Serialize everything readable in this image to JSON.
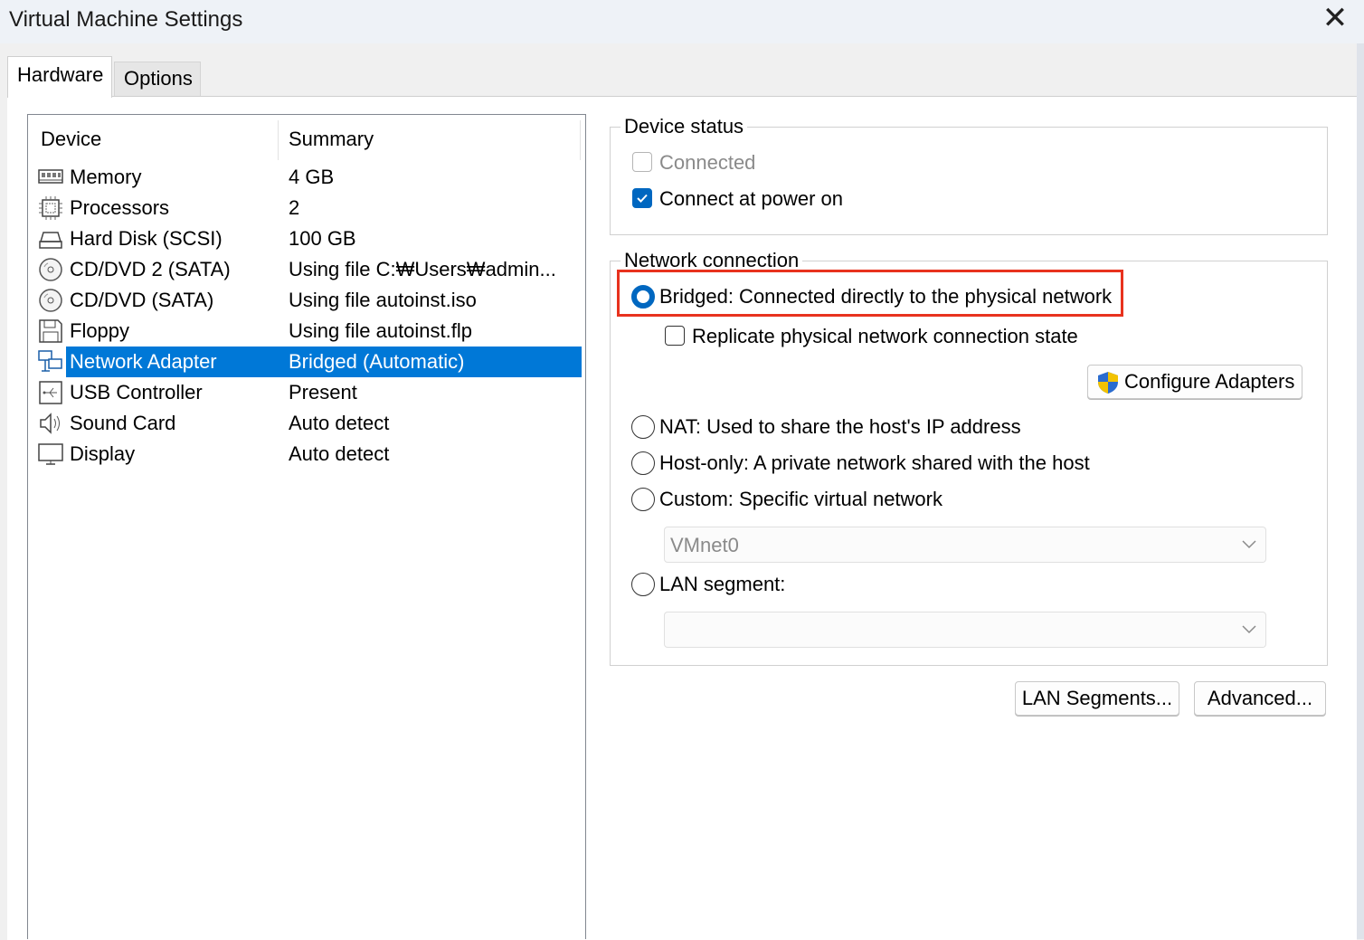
{
  "window": {
    "title": "Virtual Machine Settings",
    "close": "✕"
  },
  "tabs": [
    {
      "label": "Hardware",
      "active": true
    },
    {
      "label": "Options",
      "active": false
    }
  ],
  "device_list": {
    "headers": {
      "device": "Device",
      "summary": "Summary"
    },
    "rows": [
      {
        "icon": "memory-icon",
        "device": "Memory",
        "summary": "4 GB"
      },
      {
        "icon": "processor-icon",
        "device": "Processors",
        "summary": "2"
      },
      {
        "icon": "hard-disk-icon",
        "device": "Hard Disk (SCSI)",
        "summary": "100 GB"
      },
      {
        "icon": "cd-dvd-icon",
        "device": "CD/DVD 2 (SATA)",
        "summary": "Using file C:₩Users₩admin..."
      },
      {
        "icon": "cd-dvd-icon",
        "device": "CD/DVD (SATA)",
        "summary": "Using file autoinst.iso"
      },
      {
        "icon": "floppy-icon",
        "device": "Floppy",
        "summary": "Using file autoinst.flp"
      },
      {
        "icon": "network-adapter-icon",
        "device": "Network Adapter",
        "summary": "Bridged (Automatic)",
        "selected": true
      },
      {
        "icon": "usb-icon",
        "device": "USB Controller",
        "summary": "Present"
      },
      {
        "icon": "sound-card-icon",
        "device": "Sound Card",
        "summary": "Auto detect"
      },
      {
        "icon": "display-icon",
        "device": "Display",
        "summary": "Auto detect"
      }
    ]
  },
  "device_status": {
    "title": "Device status",
    "connected": {
      "label": "Connected",
      "checked": false,
      "disabled": true
    },
    "connect_at_power_on": {
      "label": "Connect at power on",
      "checked": true
    }
  },
  "network_connection": {
    "title": "Network connection",
    "bridged": {
      "label": "Bridged: Connected directly to the physical network",
      "checked": true
    },
    "replicate": {
      "label": "Replicate physical network connection state",
      "checked": false
    },
    "configure_adapters": "Configure Adapters",
    "nat": {
      "label": "NAT: Used to share the host's IP address",
      "checked": false
    },
    "host_only": {
      "label": "Host-only: A private network shared with the host",
      "checked": false
    },
    "custom": {
      "label": "Custom: Specific virtual network",
      "checked": false
    },
    "custom_select": "VMnet0",
    "lan_segment": {
      "label": "LAN segment:",
      "checked": false
    },
    "lan_select": ""
  },
  "buttons": {
    "lan_segments": "LAN Segments...",
    "advanced": "Advanced..."
  },
  "colors": {
    "selection": "#0078d7",
    "checkbox": "#0067c0",
    "highlight": "#e8321e"
  }
}
